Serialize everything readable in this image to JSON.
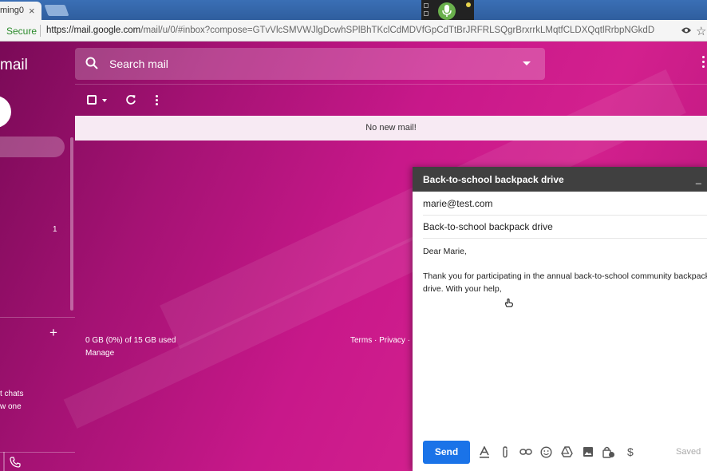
{
  "browser": {
    "tab_title": "ming0",
    "tab_close": "×",
    "secure_label": "Secure",
    "url_host": "https://mail.google.com",
    "url_rest": "/mail/u/0/#inbox?compose=GTvVlcSMVWJlgDcwhSPlBhTKclCdMDVfGpCdTtBrJRFRLSQgrBrxrrkLMqtfCLDXQqtlRrbpNGkdD",
    "star": "☆"
  },
  "gmail": {
    "logo": "mail",
    "search_placeholder": "Search mail",
    "unread_count": "1",
    "hangouts_add": "+",
    "chats_line1": "t chats",
    "chats_line2": "w one",
    "no_new_mail": "No new mail!",
    "storage": "0 GB (0%) of 15 GB used",
    "manage": "Manage",
    "footer_links": "Terms · Privacy ·"
  },
  "compose": {
    "title": "Back-to-school backpack drive",
    "minimize": "_",
    "to": "marie@test.com",
    "subject": "Back-to-school backpack drive",
    "greeting": "Dear Marie,",
    "body_line1": "Thank you for participating in the annual back-to-school community backpack",
    "body_line2": "drive. With your help,",
    "send_label": "Send",
    "saved_label": "Saved",
    "dollar": "$"
  },
  "colors": {
    "accent_blue": "#1a73e8",
    "compose_header": "#404040",
    "theme_magenta": "#c8188a"
  }
}
